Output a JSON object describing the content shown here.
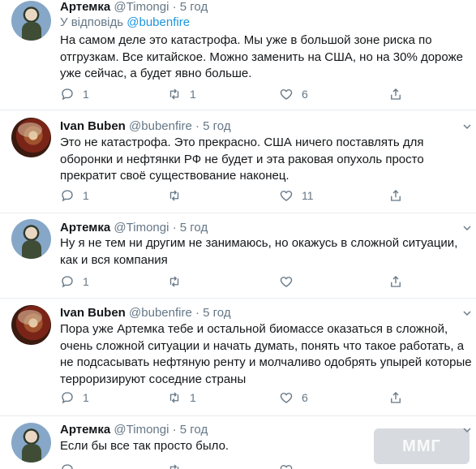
{
  "tweets": [
    {
      "name": "Артемка",
      "handle": "@Timongi",
      "dot": "·",
      "time": "5 год",
      "reply_prefix": "У відповідь",
      "reply_mention": "@bubenfire",
      "text": "На самом деле это катастрофа. Мы уже в большой зоне риска по отгрузкам. Все китайское. Можно заменить на США, но на 30% дороже уже сейчас, а будет явно больше.",
      "replies": "1",
      "retweets": "1",
      "likes": "6"
    },
    {
      "name": "Ivan Buben",
      "handle": "@bubenfire",
      "dot": "·",
      "time": "5 год",
      "text": "Это не катастрофа. Это прекрасно. США ничего поставлять для оборонки и нефтянки РФ не будет и эта раковая опухоль просто прекратит своё существование наконец.",
      "replies": "1",
      "retweets": "",
      "likes": "11"
    },
    {
      "name": "Артемка",
      "handle": "@Timongi",
      "dot": "·",
      "time": "5 год",
      "text": "Ну я не тем ни другим не занимаюсь, но окажусь в сложной ситуации, как и вся компания",
      "replies": "1",
      "retweets": "",
      "likes": ""
    },
    {
      "name": "Ivan Buben",
      "handle": "@bubenfire",
      "dot": "·",
      "time": "5 год",
      "text": "Пора уже Артемка тебе и остальной биомассе оказаться в сложной, очень сложной ситуации и начать думать, понять что такое работать, а не подсасывать нефтяную ренту и молчаливо одобрять упырей которые терроризируют соседние страны",
      "replies": "1",
      "retweets": "1",
      "likes": "6"
    },
    {
      "name": "Артемка",
      "handle": "@Timongi",
      "dot": "·",
      "time": "5 год",
      "text": "Если бы все так просто было.",
      "replies": "",
      "retweets": "",
      "likes": ""
    }
  ],
  "watermark": "ММГ",
  "colors": {
    "accent": "#1b95e0",
    "muted": "#657786",
    "text": "#14171a",
    "divider": "#e6ecf0"
  },
  "icons": [
    "reply-icon",
    "retweet-icon",
    "like-icon",
    "share-icon",
    "chevron-down-icon"
  ]
}
